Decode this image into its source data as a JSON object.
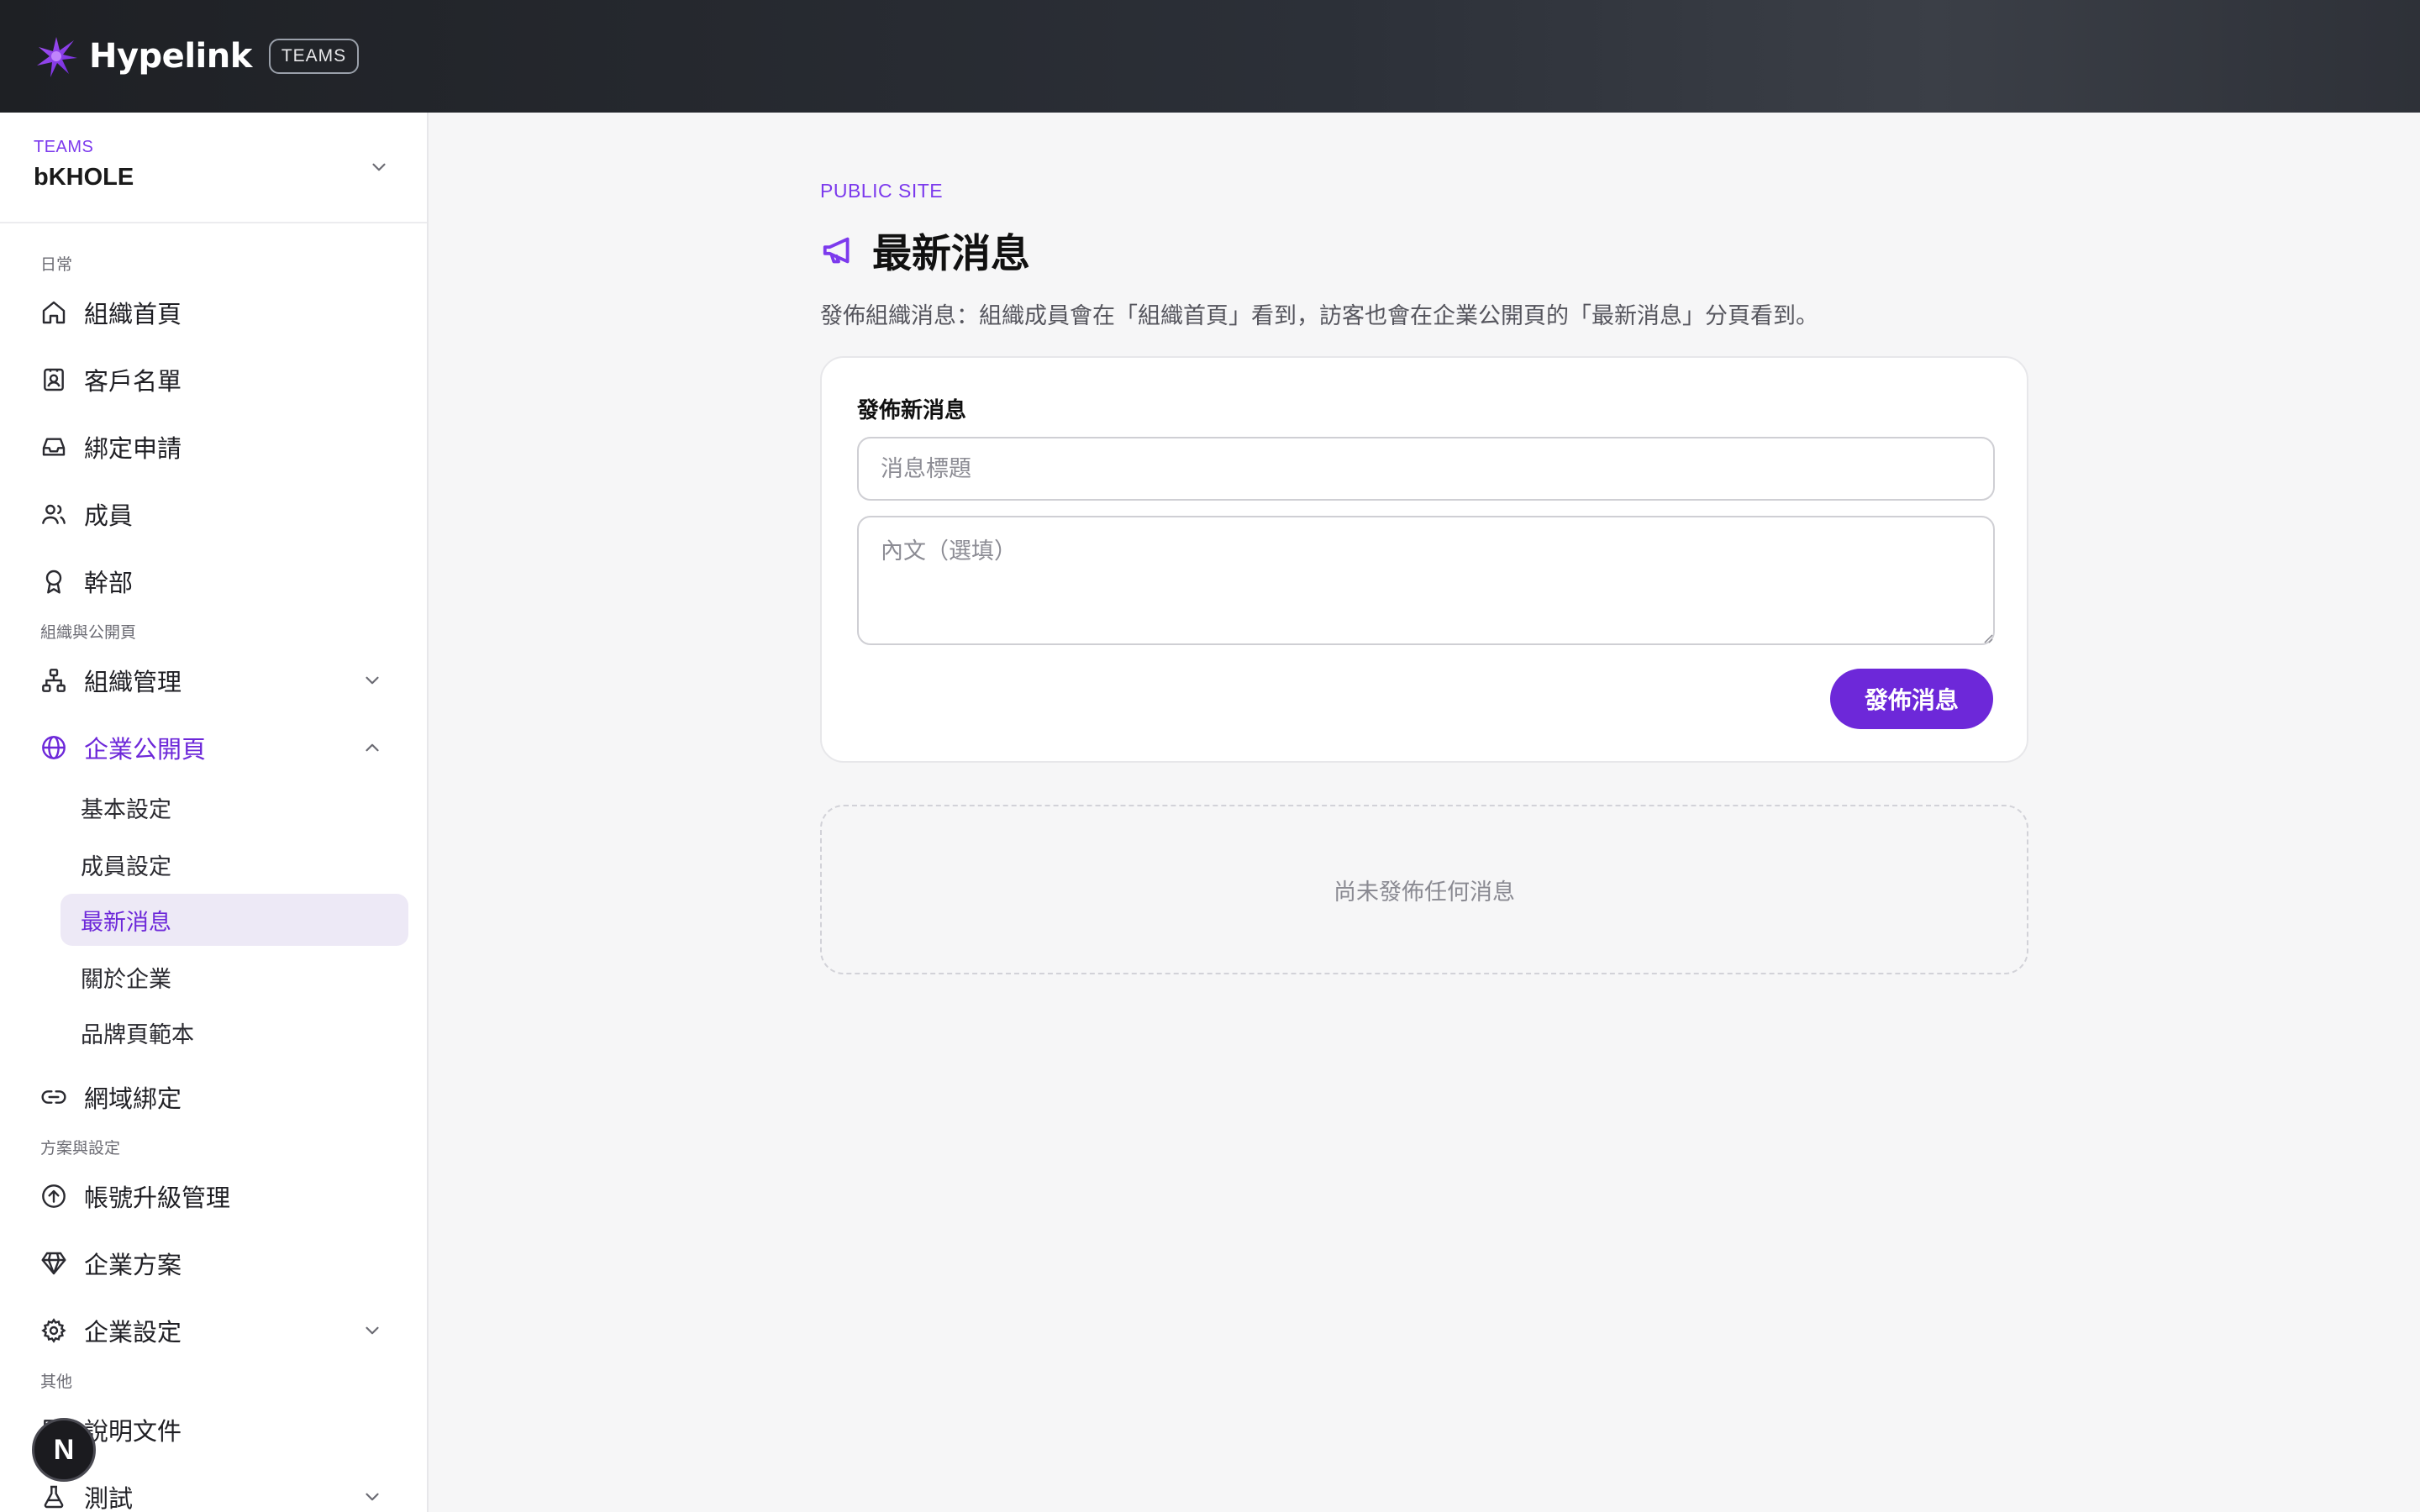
{
  "header": {
    "logo_text": "Hypelink",
    "badge": "TEAMS",
    "accent": "#7c3aed"
  },
  "team_switcher": {
    "label": "TEAMS",
    "name": "bKHOLE"
  },
  "sidebar": {
    "sections": {
      "daily": "日常",
      "org_public": "組織與公開頁",
      "plan_settings": "方案與設定",
      "other": "其他"
    },
    "items": {
      "org_home": "組織首頁",
      "clients": "客戶名單",
      "bind_requests": "綁定申請",
      "members": "成員",
      "officers": "幹部",
      "org_manage": "組織管理",
      "public_page": "企業公開頁",
      "domain_binding": "網域綁定",
      "upgrade": "帳號升級管理",
      "enterprise_plan": "企業方案",
      "enterprise_settings": "企業設定",
      "docs": "說明文件",
      "test": "測試"
    },
    "public_page_sub": {
      "basic": "基本設定",
      "member_settings": "成員設定",
      "news": "最新消息",
      "about": "關於企業",
      "brand_template": "品牌頁範本"
    }
  },
  "floating_badge": "N",
  "main": {
    "eyebrow": "PUBLIC SITE",
    "title": "最新消息",
    "description": "發佈組織消息：組織成員會在「組織首頁」看到，訪客也會在企業公開頁的「最新消息」分頁看到。",
    "form": {
      "title": "發佈新消息",
      "title_placeholder": "消息標題",
      "body_placeholder": "內文（選填）",
      "title_value": "",
      "body_value": "",
      "submit_label": "發佈消息"
    },
    "empty_state": "尚未發佈任何消息"
  }
}
